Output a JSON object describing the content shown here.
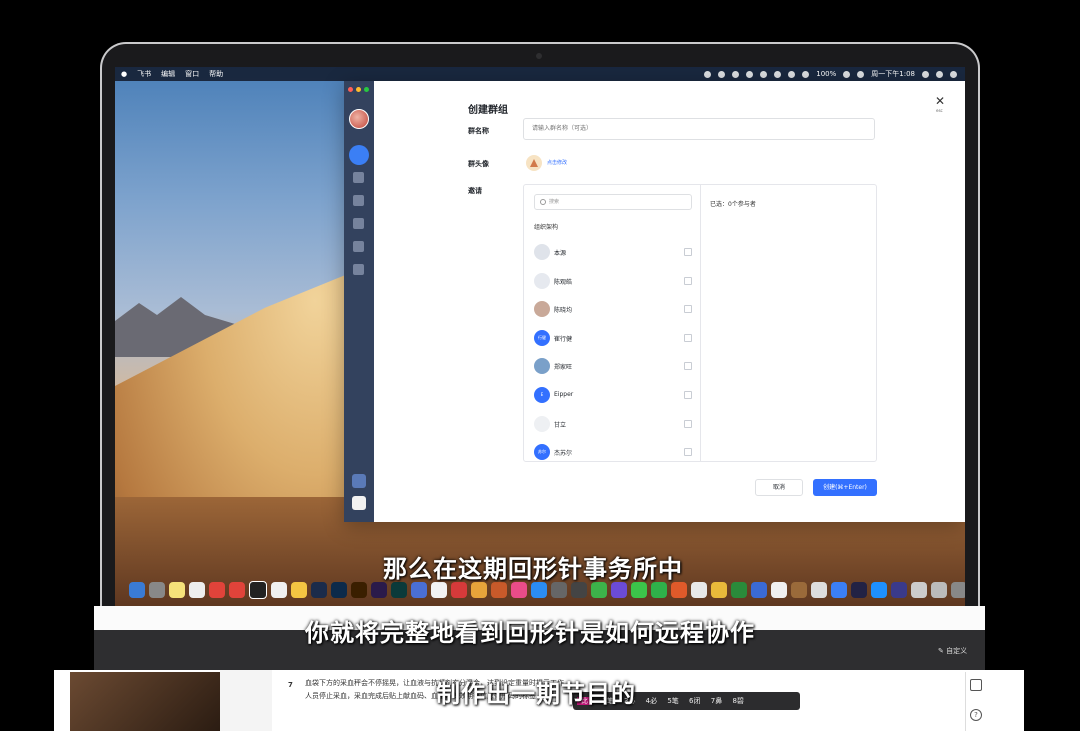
{
  "menubar": {
    "apple": "",
    "items": [
      "飞书",
      "编辑",
      "窗口",
      "帮助"
    ],
    "battery": "100%",
    "clock": "周一下午1:08"
  },
  "dialog": {
    "title": "创建群组",
    "close_hint": "esc",
    "name_label": "群名称",
    "name_placeholder": "请输入群名称（可选）",
    "avatar_label": "群头像",
    "avatar_link": "点击修改",
    "invite_label": "邀请",
    "search_placeholder": "搜索",
    "org_label": "组织架构",
    "selected_text": "已选：0个参与者",
    "members": [
      {
        "name": "本源",
        "avatar": "",
        "color": "#dfe3ea"
      },
      {
        "name": "陈观皓",
        "avatar": "",
        "color": "#e6e9ef"
      },
      {
        "name": "陈晓均",
        "avatar": "",
        "color": "#c9a999"
      },
      {
        "name": "崔行健",
        "avatar": "行健",
        "color": "#3370ff"
      },
      {
        "name": "郑家旺",
        "avatar": "",
        "color": "#7aa0c9"
      },
      {
        "name": "Eipper",
        "avatar": "E",
        "color": "#3370ff"
      },
      {
        "name": "甘立",
        "avatar": "",
        "color": "#eef0f3"
      },
      {
        "name": "杰苏尔",
        "avatar": "苏尔",
        "color": "#3370ff"
      }
    ],
    "cancel_label": "取消",
    "create_label": "创建(⌘+Enter)"
  },
  "lower": {
    "custom_label": "✎ 自定义",
    "row_number": "7",
    "row_text": "血袋下方的采血秤会不停摇晃，让血液与抗凝剂充分混合，达到设定重量时提示工作人员停止采血，采血完成后贴上献血码、血型、有效期等信息条形码的标签。",
    "ime_candidates": [
      "2笔",
      "3必",
      "4必",
      "5笔",
      "6闭",
      "7鼻",
      "8碧"
    ],
    "ime_highlight": "比"
  },
  "subtitles": {
    "line1": "那么在这期回形针事务所中",
    "line2": "你就将完整地看到回形针是如何远程协作",
    "line3": "制作出一期节目的"
  },
  "colors": {
    "accent": "#3370ff",
    "sidebar": "#33425e"
  }
}
